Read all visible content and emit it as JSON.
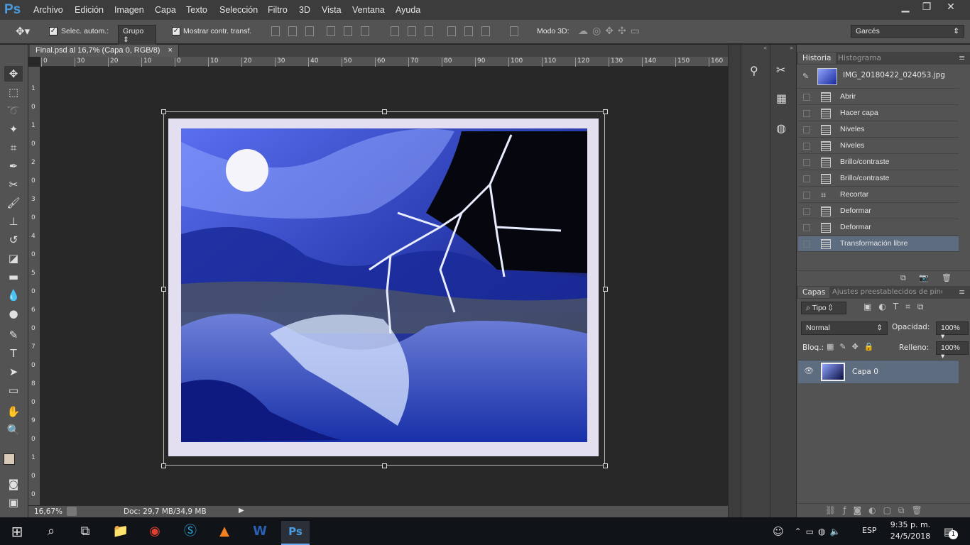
{
  "app": {
    "logo": "Ps",
    "accent": "#4a9ce0"
  },
  "menu": [
    "Archivo",
    "Edición",
    "Imagen",
    "Capa",
    "Texto",
    "Selección",
    "Filtro",
    "3D",
    "Vista",
    "Ventana",
    "Ayuda"
  ],
  "window_controls": {
    "minimize": "▁",
    "restore": "❐",
    "close": "✕"
  },
  "options": {
    "auto_select_label": "Selec. autom.:",
    "auto_select_value": "Grupo",
    "show_transform_label": "Mostrar contr. transf.",
    "mode3d_label": "Modo 3D:",
    "workspace": "Garcés"
  },
  "document": {
    "tab_title": "Final.psd al 16,7% (Capa 0, RGB/8)",
    "tab_close": "×",
    "zoom": "16,67%",
    "doc_info": "Doc: 29,7 MB/34,9 MB"
  },
  "ruler": {
    "h_ticks": [
      "0",
      "30",
      "20",
      "10",
      "0",
      "10",
      "20",
      "30",
      "40",
      "50",
      "60",
      "70",
      "80",
      "90",
      "100",
      "110",
      "120",
      "130",
      "140",
      "150",
      "160"
    ],
    "v_ticks": [
      "1",
      "0",
      "1",
      "0",
      "2",
      "0",
      "3",
      "0",
      "4",
      "0",
      "5",
      "0",
      "6",
      "0",
      "7",
      "0",
      "8",
      "0",
      "9",
      "0",
      "1",
      "0",
      "0"
    ]
  },
  "history_panel": {
    "tab_active": "Historia",
    "tab_inactive": "Histograma",
    "snapshot": "IMG_20180422_024053.jpg",
    "items": [
      "Abrir",
      "Hacer capa",
      "Niveles",
      "Niveles",
      "Brillo/contraste",
      "Brillo/contraste",
      "Recortar",
      "Deformar",
      "Deformar",
      "Transformación libre"
    ]
  },
  "layers_panel": {
    "tab_active": "Capas",
    "tab_inactive": "Ajustes preestablecidos de pincel",
    "filter_label": "Tipo",
    "blend_mode": "Normal",
    "opacity_label": "Opacidad:",
    "opacity_value": "100%",
    "lock_label": "Bloq.:",
    "fill_label": "Relleno:",
    "fill_value": "100%",
    "layers": [
      {
        "name": "Capa 0"
      }
    ]
  },
  "taskbar": {
    "time": "9:35 p. m.",
    "date": "24/5/2018",
    "lang": "ESP",
    "notif_count": "1"
  }
}
